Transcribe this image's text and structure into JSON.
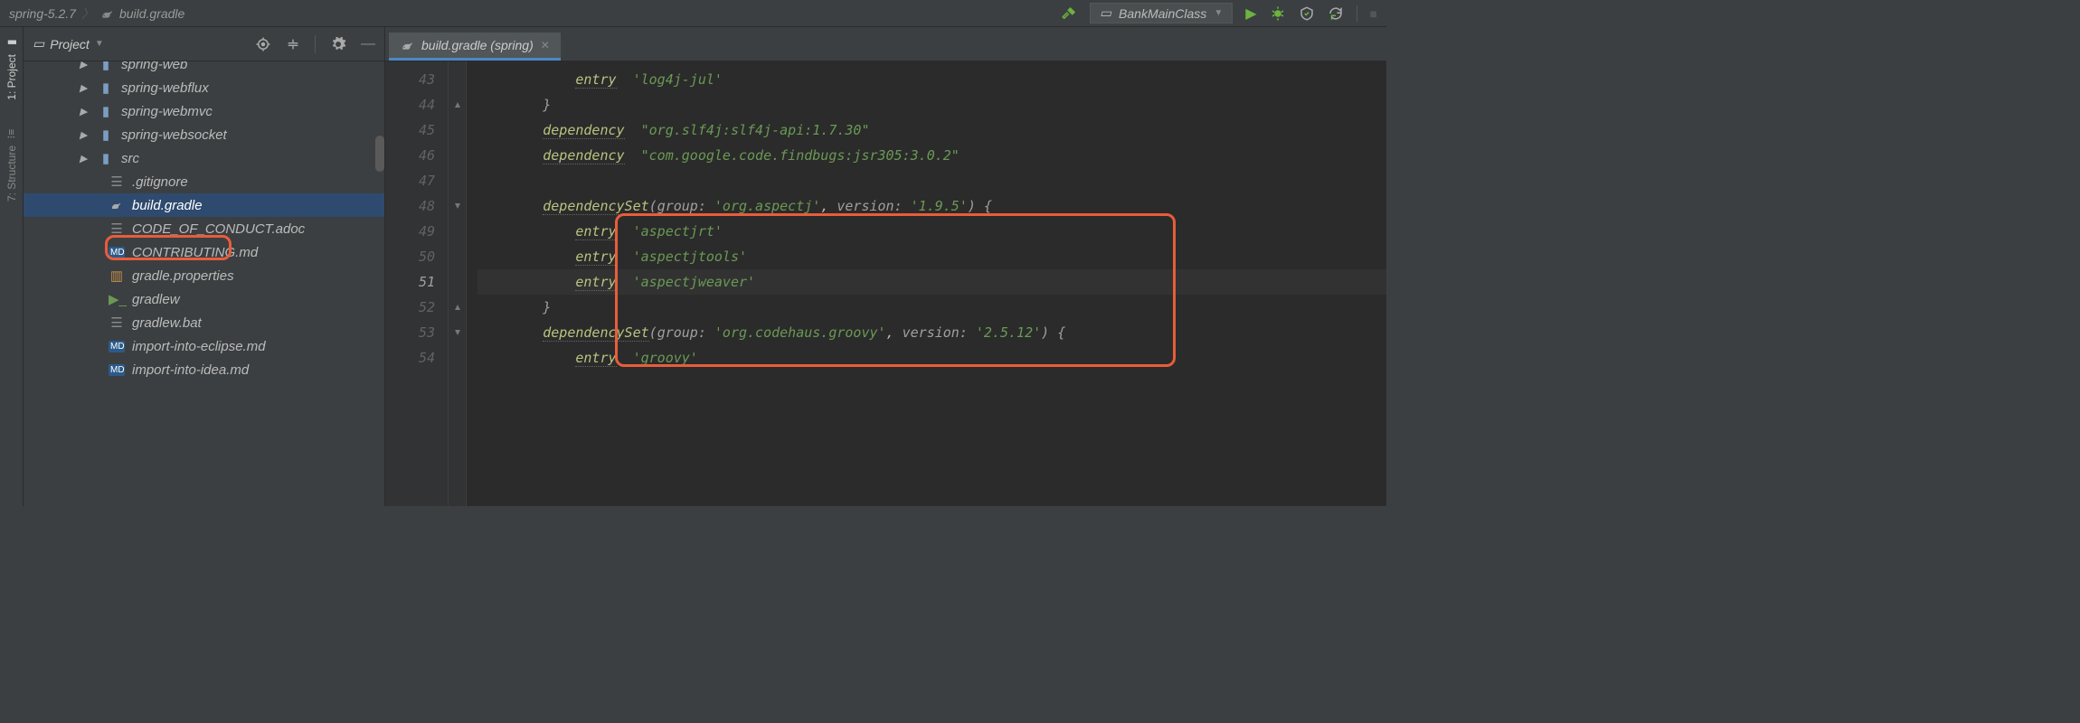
{
  "breadcrumb": {
    "project": "spring-5.2.7",
    "file": "build.gradle"
  },
  "run_config": {
    "name": "BankMainClass"
  },
  "left_rail": {
    "project_tab": "1: Project",
    "structure_tab": "7: Structure"
  },
  "project_panel": {
    "title": "Project"
  },
  "tree": {
    "items": [
      {
        "label": "spring-web",
        "type": "folder",
        "depth": 1,
        "arrow": true,
        "cut": true
      },
      {
        "label": "spring-webflux",
        "type": "folder",
        "depth": 1,
        "arrow": true
      },
      {
        "label": "spring-webmvc",
        "type": "folder",
        "depth": 1,
        "arrow": true
      },
      {
        "label": "spring-websocket",
        "type": "folder",
        "depth": 1,
        "arrow": true
      },
      {
        "label": "src",
        "type": "folder-plain",
        "depth": 1,
        "arrow": true
      },
      {
        "label": ".gitignore",
        "type": "txt",
        "depth": 2
      },
      {
        "label": "build.gradle",
        "type": "gradle",
        "depth": 2,
        "selected": true
      },
      {
        "label": "CODE_OF_CONDUCT.adoc",
        "type": "txt",
        "depth": 2
      },
      {
        "label": "CONTRIBUTING.md",
        "type": "md",
        "depth": 2
      },
      {
        "label": "gradle.properties",
        "type": "props",
        "depth": 2
      },
      {
        "label": "gradlew",
        "type": "sh",
        "depth": 2
      },
      {
        "label": "gradlew.bat",
        "type": "txt",
        "depth": 2
      },
      {
        "label": "import-into-eclipse.md",
        "type": "md",
        "depth": 2
      },
      {
        "label": "import-into-idea.md",
        "type": "md",
        "depth": 2
      }
    ]
  },
  "editor": {
    "tab_label": "build.gradle (spring)",
    "lines": [
      {
        "n": 43,
        "html": "            <span class='method'>entry</span>  <span class='str'>'log4j-jul'</span>"
      },
      {
        "n": 44,
        "html": "        <span class='paren'>}</span>",
        "fold": "up"
      },
      {
        "n": 45,
        "html": "        <span class='method'>dependency</span>  <span class='str'>\"org.slf4j:slf4j-api:1.7.30\"</span>"
      },
      {
        "n": 46,
        "html": "        <span class='method'>dependency</span>  <span class='str'>\"com.google.code.findbugs:jsr305:3.0.2\"</span>"
      },
      {
        "n": 47,
        "html": ""
      },
      {
        "n": 48,
        "html": "        <span class='method'>dependencySet</span><span class='paren'>(</span><span class='prop'>group:</span> <span class='str'>'org.aspectj'</span>, <span class='prop'>version:</span> <span class='str'>'1.9.5'</span><span class='paren'>)</span> <span class='paren'>{</span>",
        "fold": "down"
      },
      {
        "n": 49,
        "html": "            <span class='method'>entry</span>  <span class='str'>'aspectjrt'</span>"
      },
      {
        "n": 50,
        "html": "            <span class='method'>entry</span>  <span class='str'>'aspectjtools'</span>"
      },
      {
        "n": 51,
        "html": "            <span class='method'>entry</span>  <span class='str'>'aspectjweaver'</span>",
        "current": true
      },
      {
        "n": 52,
        "html": "        <span class='paren'>}</span>",
        "fold": "up"
      },
      {
        "n": 53,
        "html": "        <span class='method'>dependencySet</span><span class='paren'>(</span><span class='prop'>group:</span> <span class='str'>'org.codehaus.groovy'</span>, <span class='prop'>version:</span> <span class='str'>'2.5.12'</span><span class='paren'>)</span> <span class='paren'>{</span>",
        "fold": "down"
      },
      {
        "n": 54,
        "html": "            <span class='method'>entry</span>  <span class='str'>'groovy'</span>"
      }
    ]
  }
}
